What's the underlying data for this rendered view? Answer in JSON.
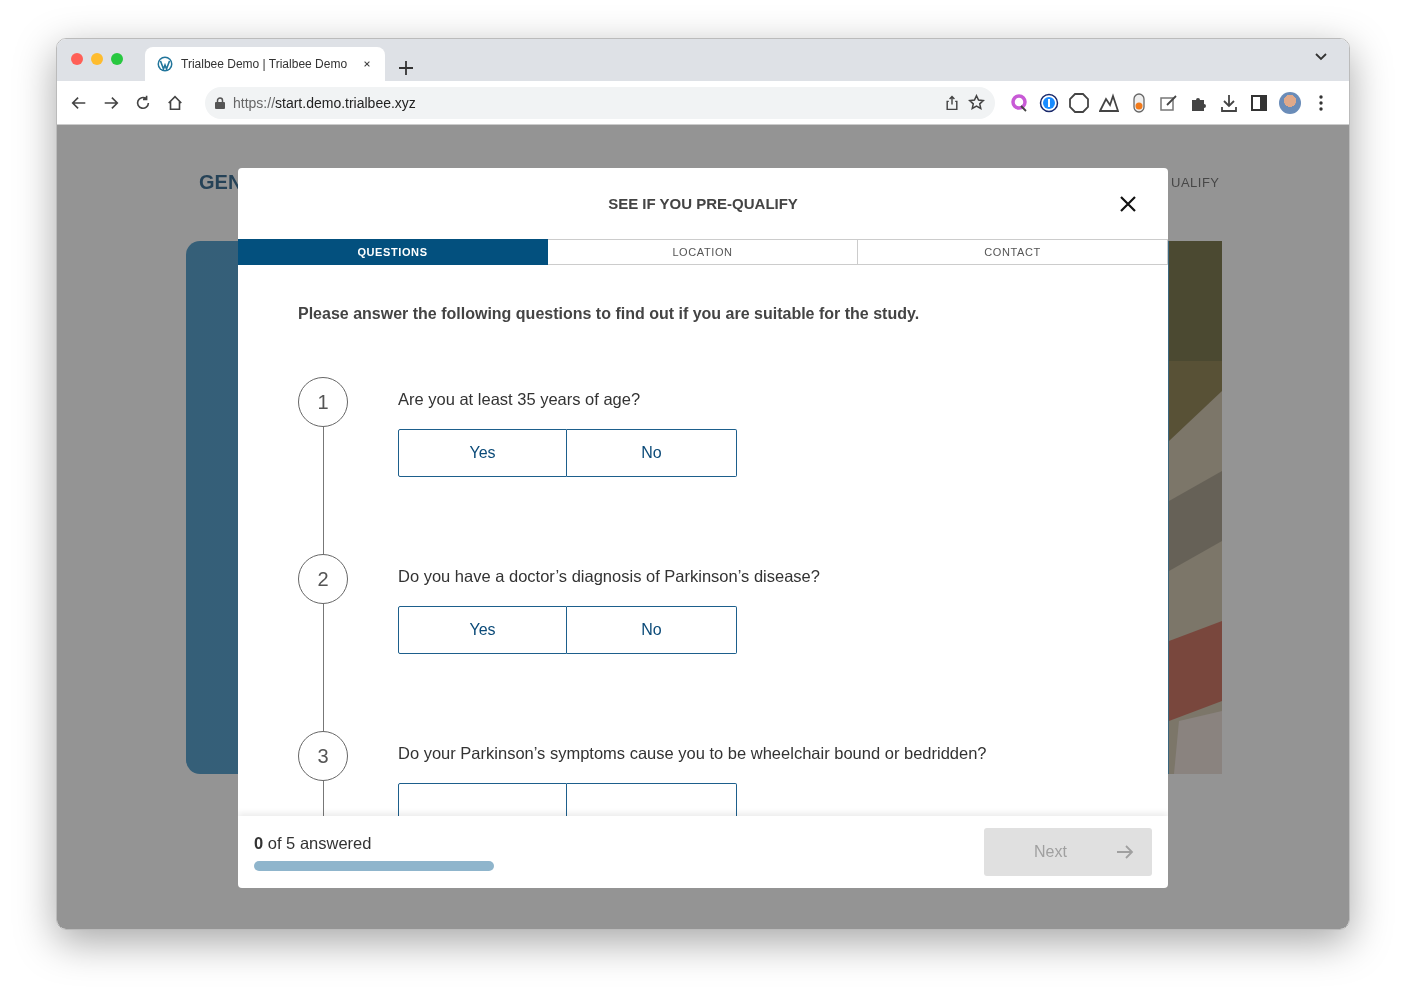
{
  "browser": {
    "tab": {
      "title": "Trialbee Demo | Trialbee Demo"
    },
    "url_scheme": "https://",
    "url_host": "start.demo.trialbee.xyz"
  },
  "page": {
    "logo": "GEN",
    "nav_text": "UALIFY"
  },
  "modal": {
    "title": "SEE IF YOU PRE-QUALIFY",
    "tabs": [
      {
        "label": "QUESTIONS",
        "selected": true
      },
      {
        "label": "LOCATION",
        "selected": false
      },
      {
        "label": "CONTACT",
        "selected": false
      }
    ],
    "intro": "Please answer the following questions to find out if you are suitable for the study.",
    "questions": [
      {
        "number": "1",
        "text": "Are you at least 35 years of age?",
        "options": [
          {
            "kind": "button",
            "label": "Yes"
          },
          {
            "kind": "button",
            "label": "No"
          }
        ]
      },
      {
        "number": "2",
        "text": "Do you have a doctor’s diagnosis of Parkinson’s disease?",
        "options": [
          {
            "kind": "button",
            "label": "Yes"
          },
          {
            "kind": "button",
            "label": "No"
          }
        ]
      },
      {
        "number": "3",
        "text": "Do your Parkinson’s symptoms cause you to be wheelchair bound or bedridden?",
        "options": [
          {
            "kind": "button"
          },
          {
            "kind": "button"
          }
        ]
      }
    ],
    "footer": {
      "answered": "**0** of 5 answered",
      "level": 0,
      "next": {
        "label": "Next",
        "disabled": true
      }
    }
  }
}
